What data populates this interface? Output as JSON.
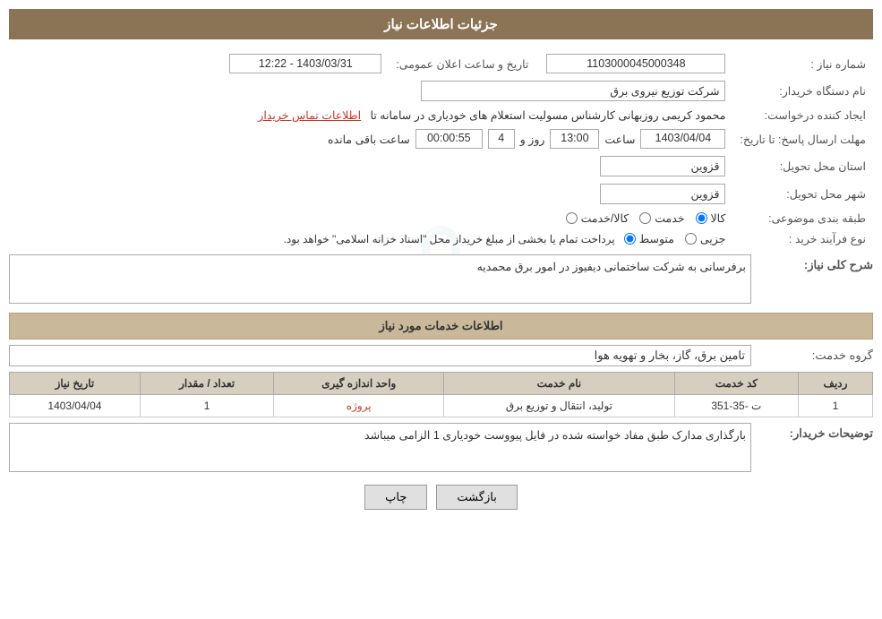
{
  "header": {
    "title": "جزئیات اطلاعات نیاز"
  },
  "fields": {
    "need_number_label": "شماره نیاز :",
    "need_number_value": "1103000045000348",
    "buyer_org_label": "نام دستگاه خریدار:",
    "buyer_org_value": "شرکت توزیع نیروی برق",
    "creator_label": "ایجاد کننده درخواست:",
    "creator_value": "محمود کریمی روزبهانی کارشناس  مسولیت استعلام های خودیاری در سامانه تا",
    "creator_link": "اطلاعات تماس خریدار",
    "deadline_label": "مهلت ارسال پاسخ: تا تاریخ:",
    "deadline_date": "1403/04/04",
    "deadline_time_label": "ساعت",
    "deadline_time": "13:00",
    "deadline_day_label": "روز و",
    "deadline_days": "4",
    "deadline_remain_label": "ساعت باقی مانده",
    "deadline_remain": "00:00:55",
    "province_label": "استان محل تحویل:",
    "province_value": "قزوین",
    "city_label": "شهر محل تحویل:",
    "city_value": "قزوین",
    "category_label": "طبقه بندی موضوعی:",
    "category_radio1": "کالا",
    "category_radio2": "خدمت",
    "category_radio3": "کالا/خدمت",
    "category_selected": "کالا",
    "process_label": "نوع فرآیند خرید :",
    "process_radio1": "جزیی",
    "process_radio2": "متوسط",
    "process_note": "پرداخت تمام یا بخشی از مبلغ خریداز محل \"اسناد خزانه اسلامی\" خواهد بود.",
    "description_label": "شرح کلی نیاز:",
    "description_value": "برفرسانی به شرکت ساختمانی دیفیوز در امور برق محمدیه",
    "services_header": "اطلاعات خدمات مورد نیاز",
    "service_group_label": "گروه خدمت:",
    "service_group_value": "تامین برق، گاز، بخار و تهویه هوا",
    "table_headers": {
      "row": "ردیف",
      "code": "کد خدمت",
      "name": "نام خدمت",
      "unit": "واحد اندازه گیری",
      "quantity": "تعداد / مقدار",
      "date": "تاریخ نیاز"
    },
    "table_rows": [
      {
        "row": "1",
        "code": "ت -35-351",
        "name": "تولید، انتقال و توزیع برق",
        "unit": "پروژه",
        "quantity": "1",
        "date": "1403/04/04"
      }
    ],
    "buyer_notes_label": "توضیحات خریدار:",
    "buyer_notes_value": "بارگذاری مدارک طبق مفاد خواسته شده در فایل پیووست خودیاری 1 الزامی میباشد",
    "announce_date_label": "تاریخ و ساعت اعلان عمومی:",
    "announce_date_value": "1403/03/31 - 12:22"
  },
  "buttons": {
    "print": "چاپ",
    "back": "بازگشت"
  }
}
